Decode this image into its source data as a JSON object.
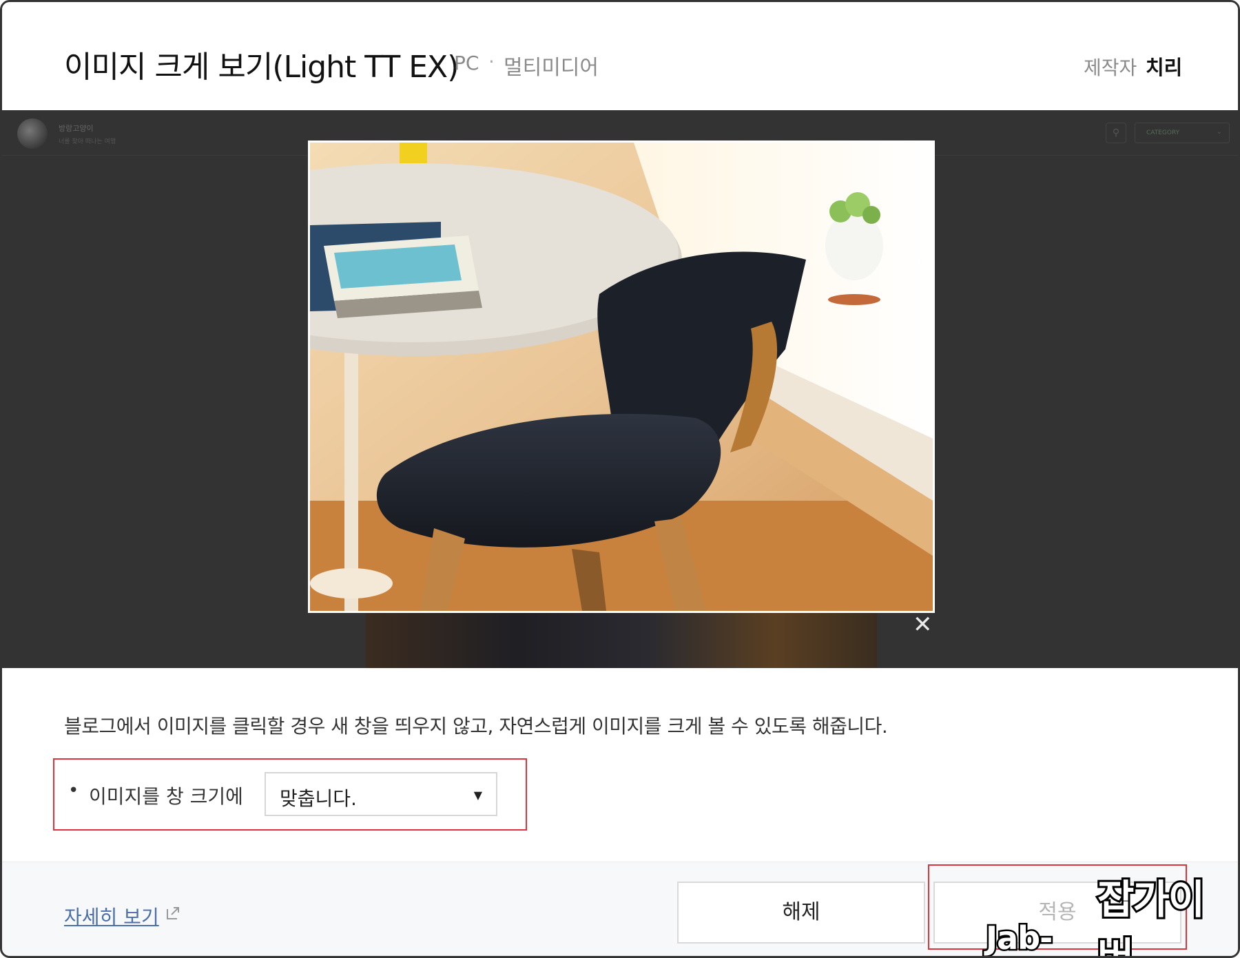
{
  "header": {
    "title": "이미지 크게 보기(Light TT EX)",
    "platform": "PC",
    "separator": "·",
    "category": "멀티미디어",
    "maker_label": "제작자",
    "maker_name": "치리"
  },
  "preview": {
    "blog_name": "방랑고양이",
    "blog_subtitle": "너를 찾아 떠나는 여행",
    "category_select": "CATEGORY",
    "photo_alt": "chair-and-table-photo",
    "close_symbol": "✕"
  },
  "description": "블로그에서 이미지를 클릭할 경우 새 창을 띄우지 않고, 자연스럽게 이미지를 크게 볼 수 있도록 해줍니다.",
  "option": {
    "bullet": "•",
    "label": "이미지를 창 크기에",
    "selected": "맞춥니다."
  },
  "footer": {
    "detail_link": "자세히 보기",
    "release_button": "해제",
    "apply_button": "적용"
  },
  "watermark": {
    "line1": "잡가이버",
    "line2": "Jab-guyver.co.kr"
  },
  "colors": {
    "highlight": "#e0323a",
    "preview_bg": "#333333",
    "link": "#4a6ea8"
  }
}
